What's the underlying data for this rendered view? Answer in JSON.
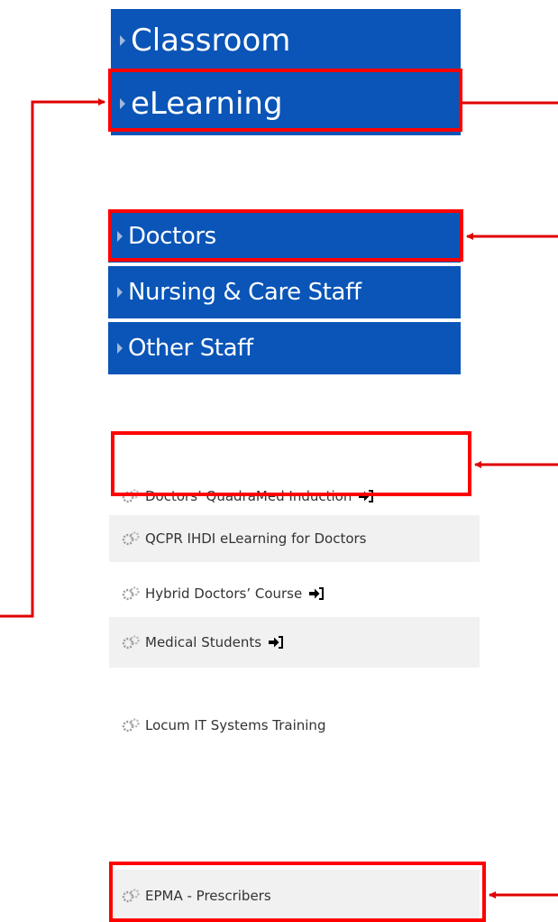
{
  "delivery_categories": [
    "Classroom",
    "eLearning"
  ],
  "staff_categories": [
    "Doctors",
    "Nursing & Care Staff",
    "Other Staff"
  ],
  "courses": [
    {
      "label": "Doctors’ QuadraMed Induction",
      "enrol_icon": true
    },
    {
      "label": "QCPR IHDI eLearning for Doctors",
      "enrol_icon": false
    },
    {
      "label": "Hybrid Doctors’ Course",
      "enrol_icon": true
    },
    {
      "label": "Medical Students",
      "enrol_icon": true
    },
    {
      "label": "Locum IT Systems Training",
      "enrol_icon": false
    }
  ],
  "extra_course": {
    "label": "EPMA - Prescribers"
  },
  "colors": {
    "category_bg": "#0a55b7",
    "highlight": "#ff0000",
    "shaded_row": "#f1f1f1"
  }
}
